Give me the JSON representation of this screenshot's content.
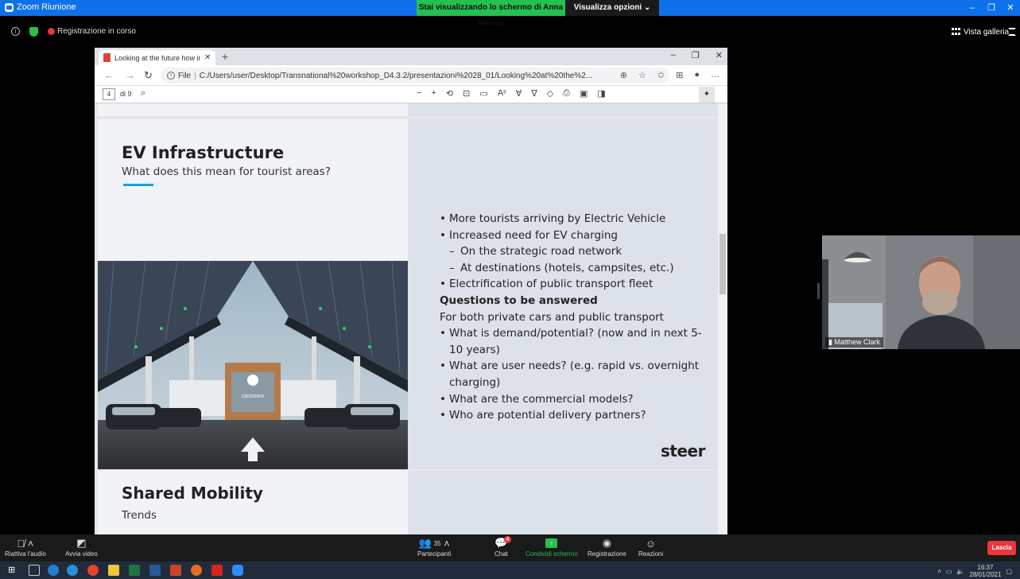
{
  "zoom": {
    "window_title": "Zoom Riunione",
    "share_banner": "Stai visualizzando lo schermo di Anna Alessio",
    "view_options": "Visualizza opzioni ⌄",
    "recording_label": "Registrazione in corso",
    "gallery_label": "Vista galleria",
    "toolbar": {
      "audio_label": "Riattiva l'audio",
      "video_label": "Avvia video",
      "participants_count": "35",
      "participants_label": "Partecipanti",
      "chat_label": "Chat",
      "chat_badge": "4",
      "share_label": "Condividi schermo",
      "record_label": "Registrazione",
      "reactions_label": "Reazioni",
      "leave_label": "Lascia"
    },
    "participant": {
      "name": "Matthew Clark"
    }
  },
  "browser": {
    "tab_title": "Looking at the future how innov",
    "address_prefix": "File",
    "address": "C:/Users/user/Desktop/Transnational%20workshop_D4.3.2/presentazioni%2028_01/Looking%20at%20the%2...",
    "pdf": {
      "page_current": "4",
      "page_of": "di 9"
    }
  },
  "slide": {
    "title": "EV Infrastructure",
    "subtitle": "What does this mean for tourist areas?",
    "bullets": [
      {
        "type": "bullet",
        "text": "More tourists arriving by Electric Vehicle"
      },
      {
        "type": "bullet",
        "text": "Increased need for EV charging"
      },
      {
        "type": "sub",
        "text": "On the strategic road network"
      },
      {
        "type": "sub",
        "text": "At destinations (hotels, campsites, etc.)"
      },
      {
        "type": "bullet",
        "text": "Electrification of public transport fleet"
      },
      {
        "type": "heading",
        "text": "Questions to be answered"
      },
      {
        "type": "plain",
        "text": "For both private cars and public transport"
      },
      {
        "type": "bullet",
        "text": "What is demand/potential? (now and in next 5-10 years)"
      },
      {
        "type": "bullet",
        "text": "What are user needs? (e.g. rapid vs. overnight charging)"
      },
      {
        "type": "bullet",
        "text": "What are the commercial models?"
      },
      {
        "type": "bullet",
        "text": "Who are potential delivery partners?"
      }
    ],
    "logo": "steer",
    "photo_sign": "GRIDSERVE"
  },
  "next_slide": {
    "title": "Shared Mobility",
    "subtitle": "Trends"
  },
  "taskbar": {
    "time": "16:37",
    "date": "28/01/2021"
  },
  "colors": {
    "zoom_blue": "#0e71eb",
    "share_green": "#24c150",
    "leave_red": "#e8383d",
    "slide_accent": "#1aa0d8"
  }
}
